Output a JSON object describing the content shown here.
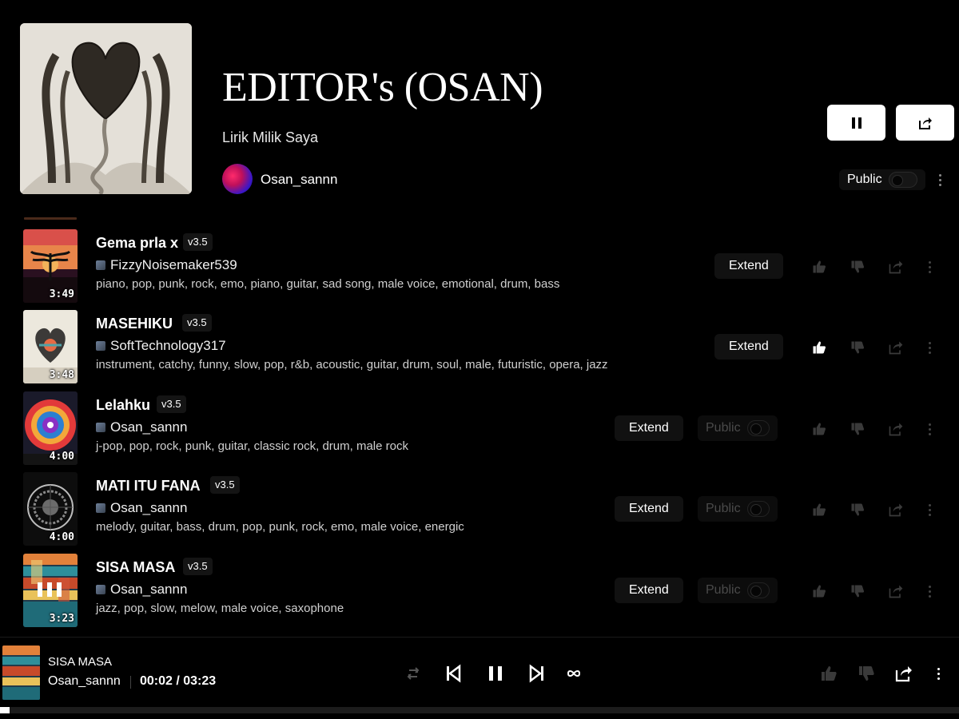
{
  "playlist": {
    "title": "EDITOR's (OSAN)",
    "subtitle": "Lirik Milik Saya",
    "owner": "Osan_sannn",
    "public_label": "Public"
  },
  "extend_label": "Extend",
  "row_public_label": "Public",
  "songs": [
    {
      "title": "Gema prla x",
      "version": "v3.5",
      "artist": "FizzyNoisemaker539",
      "tags": "piano, pop, punk, rock, emo, piano, guitar, sad song, male voice, emotional, drum, bass",
      "duration": "3:49",
      "liked": false,
      "owned": false
    },
    {
      "title": "MASEHIKU",
      "version": "v3.5",
      "artist": "SoftTechnology317",
      "tags": "instrument, catchy, funny, slow, pop, r&b, acoustic, guitar, drum, soul, male, futuristic, opera, jazz",
      "duration": "3:48",
      "liked": true,
      "owned": false
    },
    {
      "title": "Lelahku",
      "version": "v3.5",
      "artist": "Osan_sannn",
      "tags": "j-pop, pop, rock, punk, guitar, classic rock, drum, male rock",
      "duration": "4:00",
      "liked": false,
      "owned": true
    },
    {
      "title": "MATI ITU FANA",
      "version": "v3.5",
      "artist": "Osan_sannn",
      "tags": "melody, guitar, bass, drum, pop, punk, rock, emo, male voice, energic",
      "duration": "4:00",
      "liked": false,
      "owned": true
    },
    {
      "title": "SISA MASA",
      "version": "v3.5",
      "artist": "Osan_sannn",
      "tags": "jazz, pop, slow, melow, male voice, saxophone",
      "duration": "3:23",
      "liked": false,
      "owned": true,
      "playing": true
    }
  ],
  "player": {
    "title": "SISA MASA",
    "artist": "Osan_sannn",
    "time": "00:02 / 03:23",
    "progress_fraction": 0.01
  },
  "colors": {
    "background": "#000000",
    "liked": "#ffffff",
    "muted_icon": "#3a3a3a",
    "muted_text": "#4a4a4a"
  }
}
